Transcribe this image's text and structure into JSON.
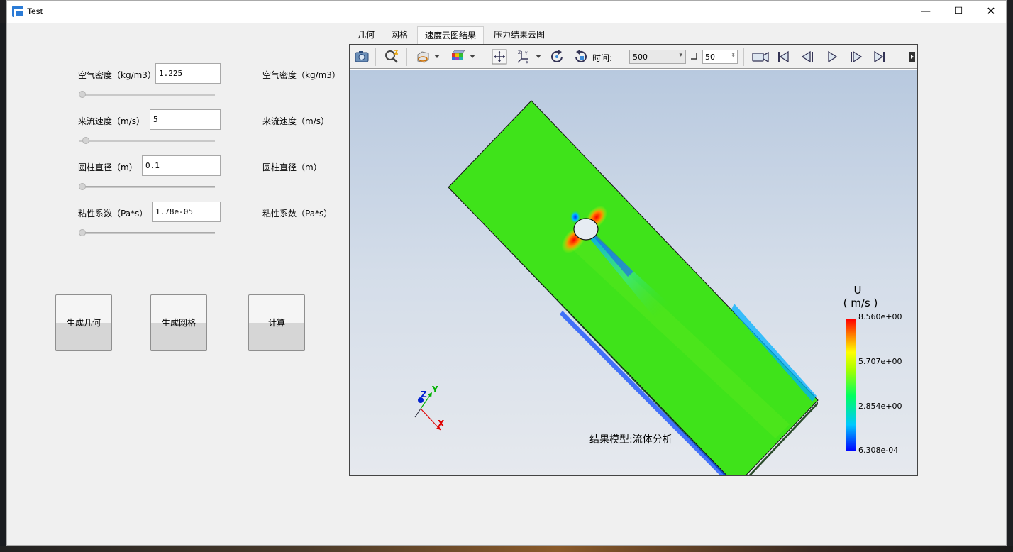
{
  "window": {
    "title": "Test",
    "minimize": "—",
    "maximize": "☐",
    "close": "✕"
  },
  "form": {
    "fields": [
      {
        "label": "空气密度（kg/m3）",
        "value": "1.225",
        "echo": "空气密度（kg/m3）",
        "slider_fraction": 0.0
      },
      {
        "label": "来流速度（m/s）",
        "value": "5",
        "echo": "来流速度（m/s）",
        "slider_fraction": 0.03
      },
      {
        "label": "圆柱直径（m）",
        "value": "0.1",
        "echo": "圆柱直径（m）",
        "slider_fraction": 0.0
      },
      {
        "label": "粘性系数（Pa*s）",
        "value": "1.78e-05",
        "echo": "粘性系数（Pa*s）",
        "slider_fraction": 0.0
      }
    ],
    "buttons": {
      "geometry": "生成几何",
      "mesh": "生成网格",
      "compute": "计算"
    }
  },
  "tabs": [
    {
      "label": "几何",
      "active": false
    },
    {
      "label": "网格",
      "active": false
    },
    {
      "label": "速度云图结果",
      "active": true
    },
    {
      "label": "压力结果云图",
      "active": false
    }
  ],
  "toolbar": {
    "time_label": "时间:",
    "time_value": "500",
    "step_value": "50",
    "icons": [
      "camera-icon",
      "zoom-fit-icon",
      "display-mode-icon",
      "color-cube-icon",
      "pan-icon",
      "axes-icon",
      "rotate-icon",
      "reset-view-icon",
      "record-icon",
      "first-frame-icon",
      "prev-frame-icon",
      "play-icon",
      "next-frame-icon",
      "last-frame-icon",
      "more-icon"
    ]
  },
  "legend": {
    "title_line1": "U",
    "title_line2": "( m/s )",
    "ticks": [
      "8.560e+00",
      "5.707e+00",
      "2.854e+00",
      "6.308e-04"
    ],
    "colors": [
      "#0000ff",
      "#00c8ff",
      "#00ff60",
      "#ffff00",
      "#ff8000",
      "#ff0000"
    ]
  },
  "axes": {
    "x": "X",
    "y": "Y",
    "z": "Z"
  },
  "caption": "结果模型:流体分析"
}
